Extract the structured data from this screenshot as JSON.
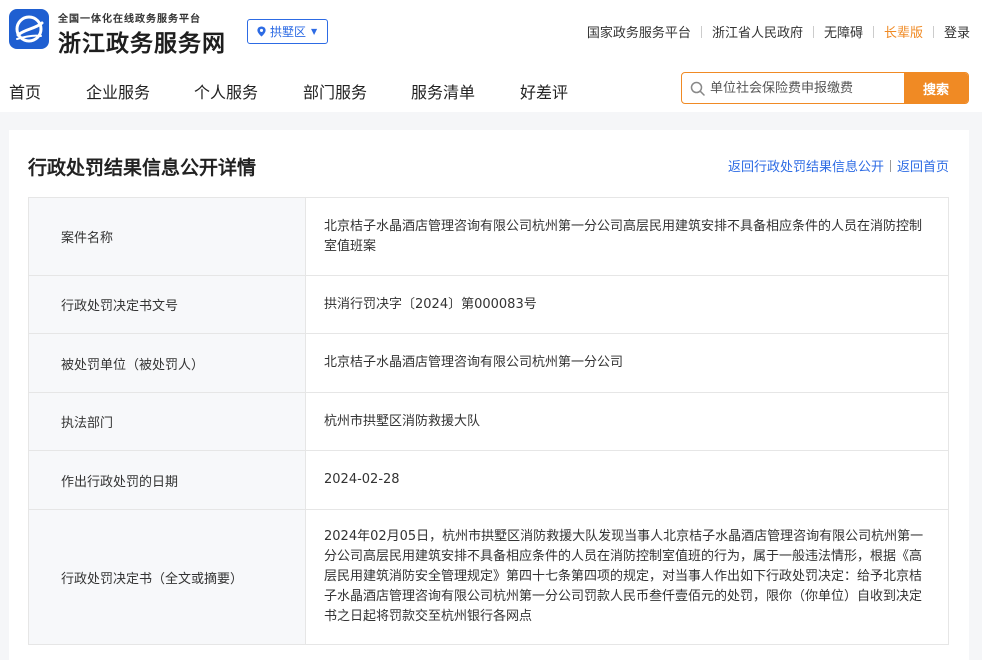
{
  "header": {
    "platform_tag": "全国一体化在线政务服务平台",
    "site_title": "浙江政务服务网",
    "region": "拱墅区",
    "top_links": [
      {
        "label": "国家政务服务平台"
      },
      {
        "label": "浙江省人民政府"
      },
      {
        "label": "无障碍"
      },
      {
        "label": "长辈版",
        "accent": "#f08a24"
      },
      {
        "label": "登录"
      }
    ]
  },
  "nav": {
    "items": [
      "首页",
      "企业服务",
      "个人服务",
      "部门服务",
      "服务清单",
      "好差评"
    ]
  },
  "search": {
    "placeholder": "单位社会保险费申报缴费",
    "button_label": "搜索"
  },
  "page": {
    "title": "行政处罚结果信息公开详情",
    "breadcrumb_back": "返回行政处罚结果信息公开",
    "breadcrumb_home": "返回首页"
  },
  "details": [
    {
      "key": "案件名称",
      "value": "北京桔子水晶酒店管理咨询有限公司杭州第一分公司高层民用建筑安排不具备相应条件的人员在消防控制室值班案"
    },
    {
      "key": "行政处罚决定书文号",
      "value": "拱消行罚决字〔2024〕第000083号"
    },
    {
      "key": "被处罚单位（被处罚人）",
      "value": "北京桔子水晶酒店管理咨询有限公司杭州第一分公司"
    },
    {
      "key": "执法部门",
      "value": "杭州市拱墅区消防救援大队"
    },
    {
      "key": "作出行政处罚的日期",
      "value": "2024-02-28"
    },
    {
      "key": "行政处罚决定书（全文或摘要）",
      "value": "2024年02月05日，杭州市拱墅区消防救援大队发现当事人北京桔子水晶酒店管理咨询有限公司杭州第一分公司高层民用建筑安排不具备相应条件的人员在消防控制室值班的行为，属于一般违法情形，根据《高层民用建筑消防安全管理规定》第四十七条第四项的规定，对当事人作出如下行政处罚决定：给予北京桔子水晶酒店管理咨询有限公司杭州第一分公司罚款人民币叁仟壹佰元的处罚，限你（你单位）自收到决定书之日起将罚款交至杭州银行各网点"
    }
  ],
  "colors": {
    "brand_blue": "#2d6be4",
    "accent_orange": "#f08a24"
  }
}
